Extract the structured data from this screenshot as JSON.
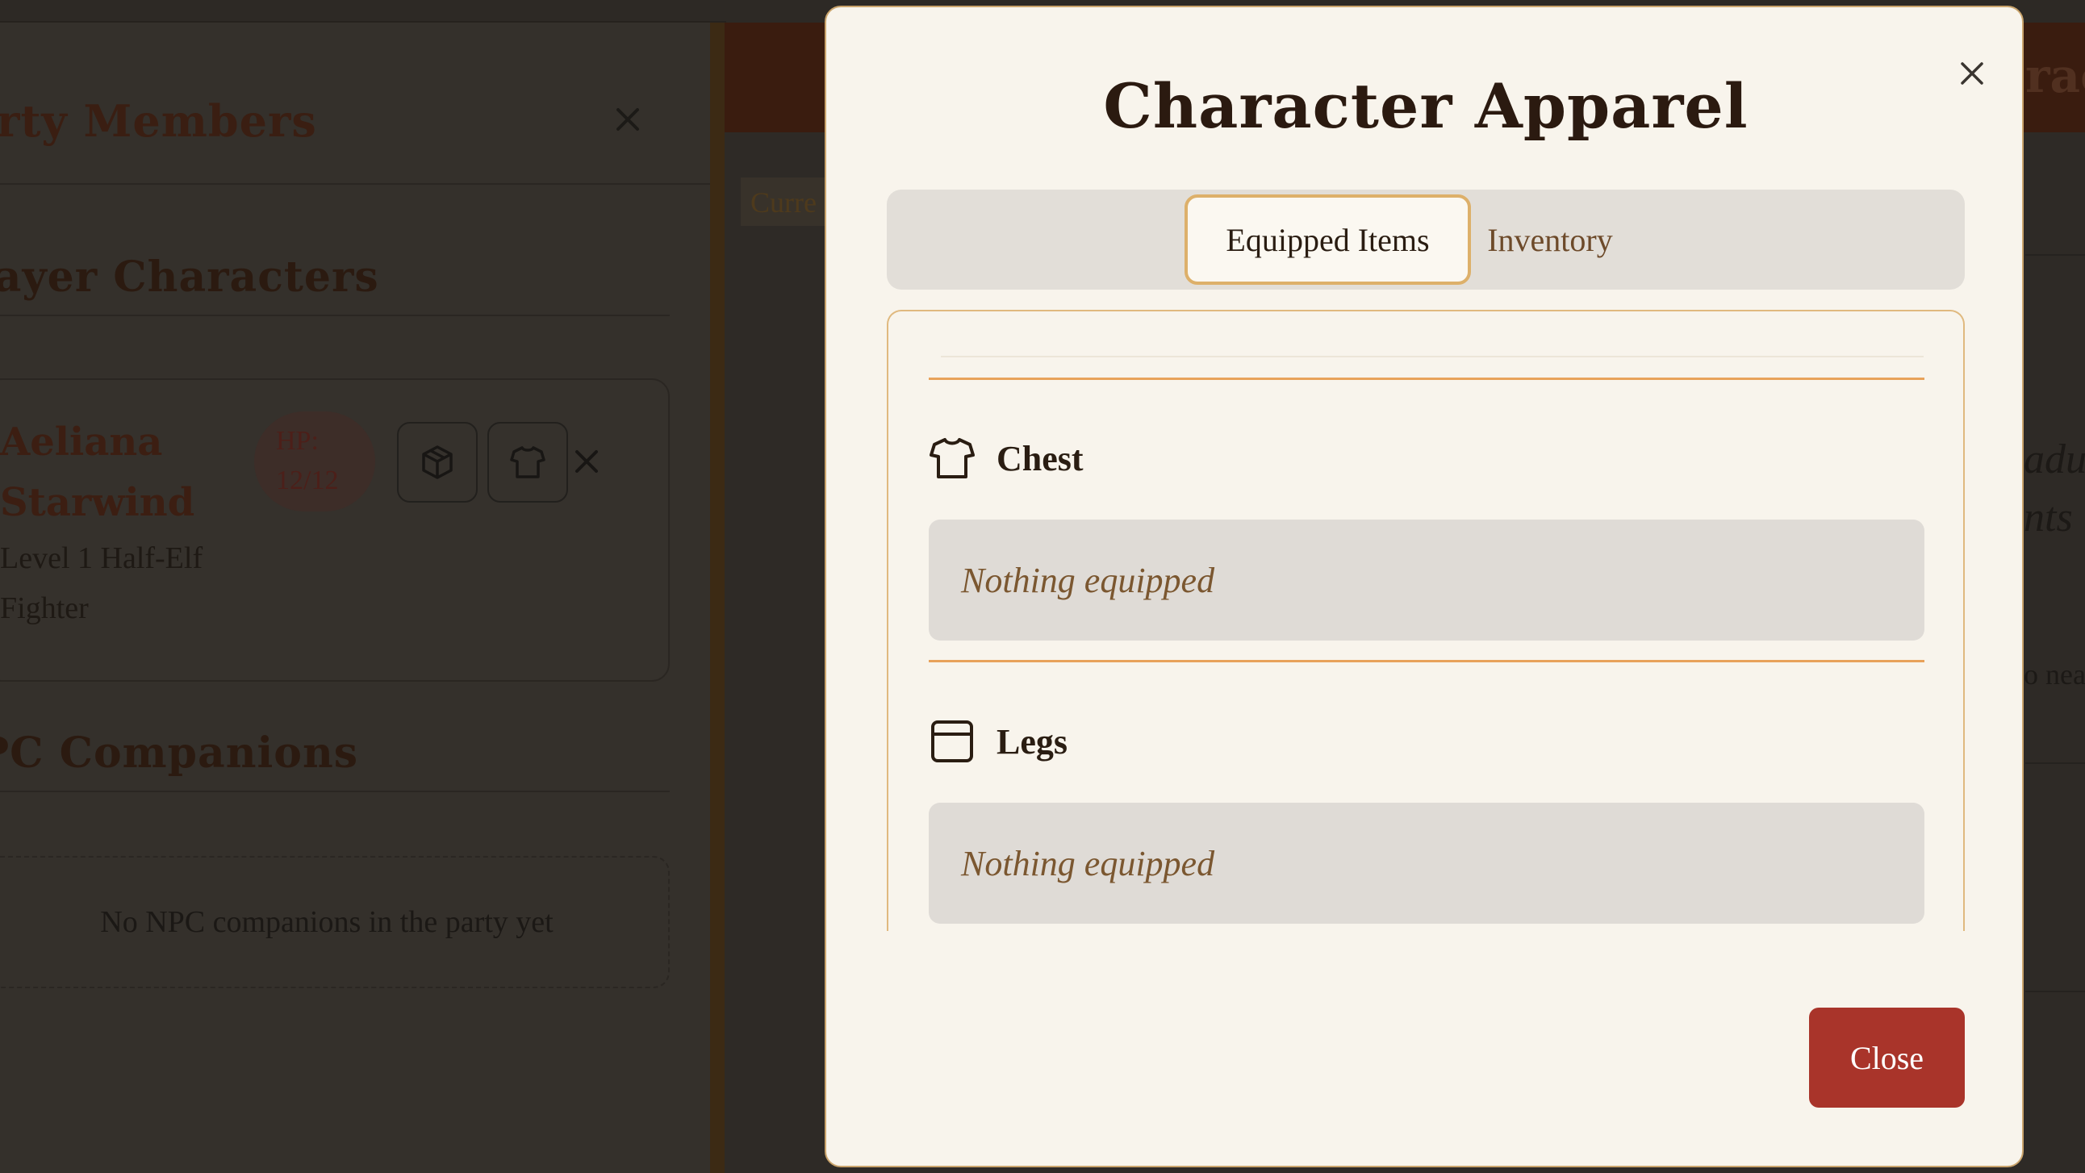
{
  "background": {
    "party_panel": {
      "title": "arty Members",
      "player_section": "layer Characters",
      "character": {
        "name": "Aeliana Starwind",
        "hp_label": "HP:",
        "hp_value": "12/12",
        "meta": "Level 1 Half-Elf Fighter",
        "inventory_icon": "box-icon",
        "apparel_icon": "shirt-icon",
        "remove_icon": "close-icon"
      },
      "npc_section": "PC Companions",
      "npc_empty": "No NPC companions in the party yet"
    },
    "main": {
      "current_badge": "Curre",
      "title_fragment": "rac",
      "frag_1": "adu",
      "frag_2": "nts",
      "frag_3": "o nea"
    }
  },
  "modal": {
    "title": "Character Apparel",
    "close_icon": "close-icon",
    "tabs": [
      {
        "label": "Equipped Items",
        "active": true
      },
      {
        "label": "Inventory",
        "active": false
      }
    ],
    "slots": [
      {
        "label": "Chest",
        "icon": "shirt-icon",
        "value": "Nothing equipped"
      },
      {
        "label": "Legs",
        "icon": "pants-icon",
        "value": "Nothing equipped"
      }
    ],
    "close_button": "Close"
  },
  "colors": {
    "accent_gold": "#ddb06a",
    "rule_orange": "#e8a25a",
    "close_red": "#a9342a",
    "modal_bg": "#f8f4ec"
  }
}
